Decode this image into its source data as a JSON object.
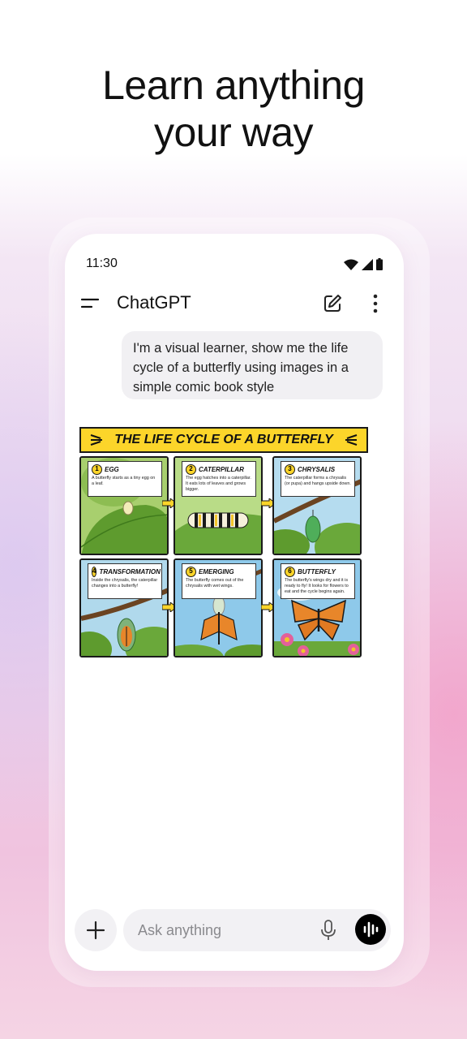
{
  "headline": {
    "line1": "Learn anything",
    "line2": "your way"
  },
  "status_bar": {
    "time": "11:30"
  },
  "app": {
    "title": "ChatGPT"
  },
  "conversation": {
    "user_message": "I'm a visual learner, show me the life cycle of a butterfly using images in a simple comic book style"
  },
  "comic": {
    "title": "THE LIFE CYCLE OF A BUTTERFLY",
    "panels": [
      {
        "number": "1",
        "label": "EGG",
        "text": "A butterfly starts as a tiny egg on a leaf."
      },
      {
        "number": "2",
        "label": "CATERPILLAR",
        "text": "The egg hatches into a caterpillar. It eats lots of leaves and grows bigger."
      },
      {
        "number": "3",
        "label": "CHRYSALIS",
        "text": "The caterpillar forms a chrysalis (or pupa) and hangs upside down."
      },
      {
        "number": "4",
        "label": "TRANSFORMATION",
        "text": "Inside the chrysalis, the caterpillar changes into a butterfly!"
      },
      {
        "number": "5",
        "label": "EMERGING",
        "text": "The butterfly comes out of the chrysalis with wet wings."
      },
      {
        "number": "6",
        "label": "BUTTERFLY",
        "text": "The butterfly's wings dry and it is ready to fly! It looks for flowers to eat and the cycle begins again."
      }
    ]
  },
  "composer": {
    "placeholder": "Ask anything"
  },
  "icons": {
    "menu": "menu-icon",
    "edit": "edit-icon",
    "more": "more-vertical-icon",
    "plus": "plus-icon",
    "mic": "mic-icon",
    "voice": "voice-waveform-icon"
  },
  "colors": {
    "comic_yellow": "#fcd52a",
    "voice_button": "#000000"
  }
}
